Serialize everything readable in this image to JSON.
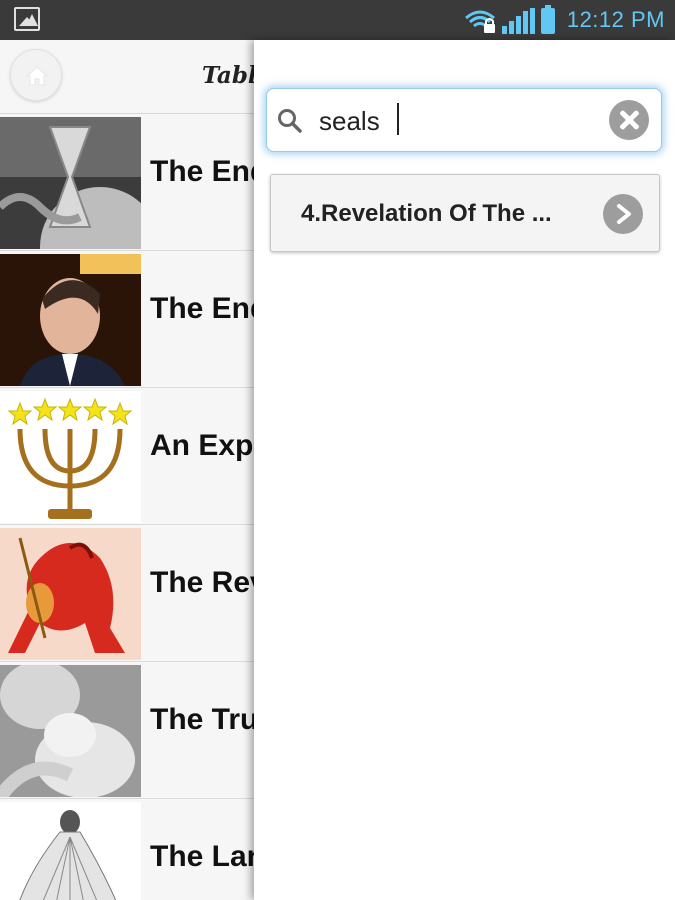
{
  "status_bar": {
    "time": "12:12 PM",
    "icons": [
      "gallery-icon",
      "wifi-lock-icon",
      "signal-icon",
      "battery-icon"
    ],
    "accent_color": "#63c7f4"
  },
  "header": {
    "title": "Tabl",
    "home_icon": "home-icon"
  },
  "list": {
    "items": [
      {
        "title": "The End",
        "thumb": "hourglass-earth-image"
      },
      {
        "title": "The End",
        "thumb": "speaker-portrait-image"
      },
      {
        "title": "An Expo",
        "thumb": "menorah-stars-image"
      },
      {
        "title": "The Rev",
        "thumb": "red-horse-rider-image"
      },
      {
        "title": "The Tru",
        "thumb": "mother-child-image"
      },
      {
        "title": "The Lar",
        "thumb": "veiled-bride-image"
      }
    ]
  },
  "search": {
    "value": "seals",
    "search_icon": "search-icon",
    "clear_icon": "clear-icon",
    "focus_color": "#9ccbe8"
  },
  "results": [
    {
      "label": "4.Revelation Of The ...",
      "icon": "chevron-right-icon"
    }
  ]
}
